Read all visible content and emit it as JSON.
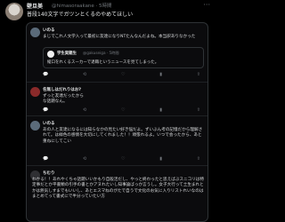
{
  "post": {
    "display_name": "壁旦美",
    "handle": "@himasoraakane · 5時間",
    "more_label": "···",
    "text": "普段140文字でガツンとくるのやめてほしい"
  },
  "replies": [
    {
      "name": "いのる",
      "meta": "",
      "text": "まじでこれ人文学入って最初に友達になりNTたんなんだよね。本当訳ありなかった",
      "quote": {
        "name": "学生実親生",
        "handle": "@gakuseiga · 5時間",
        "text": "縦口をれくるスーカーで退職というニュースを見てしまった。"
      }
    },
    {
      "name": "名無しはだれりはお?",
      "meta": "",
      "text": "ずっと友達だったから\nな話題なん。"
    },
    {
      "name": "いのる",
      "meta": "",
      "text": "あの人と友達になるには知らなかの見たい好き悩だよ。ずいぶん考の記憶だから理解されて。は緑色の感情を大切にしてくれました！！頑張れるよ。いつで会ったから、あと重ねにしてこい"
    },
    {
      "name": "ちむり",
      "meta": "",
      "text": "わかる！！あれやくちゃ話題いいかもり自殺活だし、やっと終わったと思えばぶスニコリは特定事だとか平書類の引手の書とかアヌれたいし知事論ばっか言うし。女子大行って土生まれとかは熱気しすまでもいいし、あとエスマねのがたで自うで文化のお気に入りリストれいなのはまとめてって書式にで半分っていたい方"
    }
  ],
  "action_icons": [
    "reply-icon",
    "retweet-icon",
    "like-icon",
    "views-icon",
    "share-icon"
  ],
  "action_glyphs": [
    "💬",
    "⟲",
    "♡",
    "▮",
    "⇪"
  ]
}
